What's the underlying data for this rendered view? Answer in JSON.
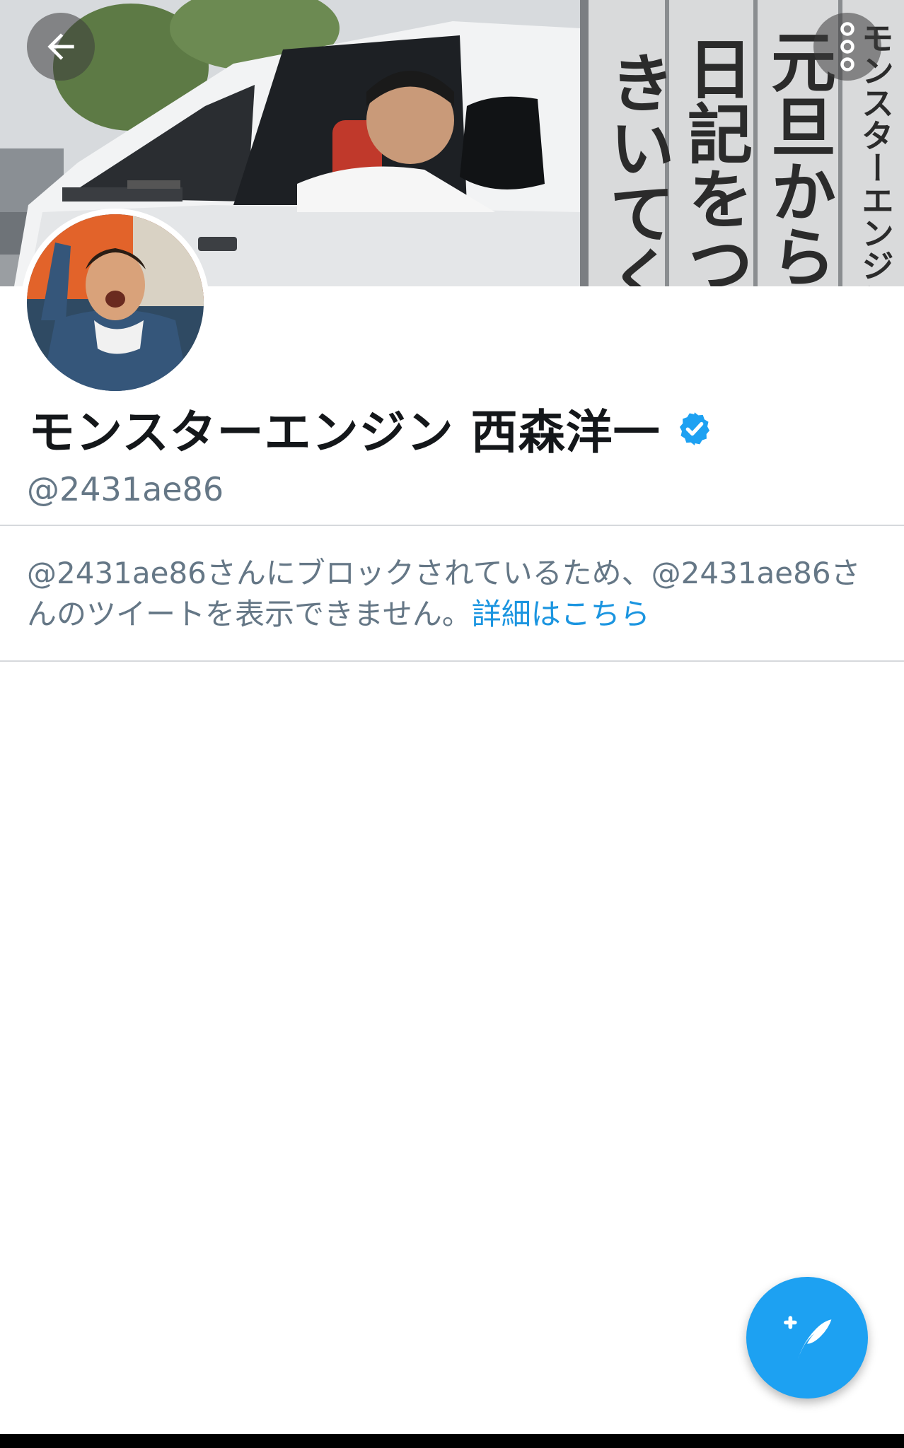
{
  "header": {
    "back_icon": "arrow-left-icon",
    "more_icon": "more-dots-icon",
    "banner_text": {
      "column_1": "モンスターエンジン西森",
      "column_2": "元旦から",
      "column_3": "日記をつけ",
      "column_4": "きいてくだ"
    }
  },
  "profile": {
    "display_name": "モンスターエンジン 西森洋一",
    "verified_icon": "verified-badge-icon",
    "handle": "@2431ae86"
  },
  "blocked_notice": {
    "message": "@2431ae86さんにブロックされているため、@2431ae86さんのツイートを表示できません。",
    "learn_more": "詳細はこちら"
  },
  "fab": {
    "icon": "compose-tweet-icon"
  },
  "colors": {
    "accent": "#1da1f2",
    "link": "#1b95e0",
    "secondary_text": "#657786",
    "primary_text": "#14171a",
    "divider": "#d6d9dc"
  }
}
